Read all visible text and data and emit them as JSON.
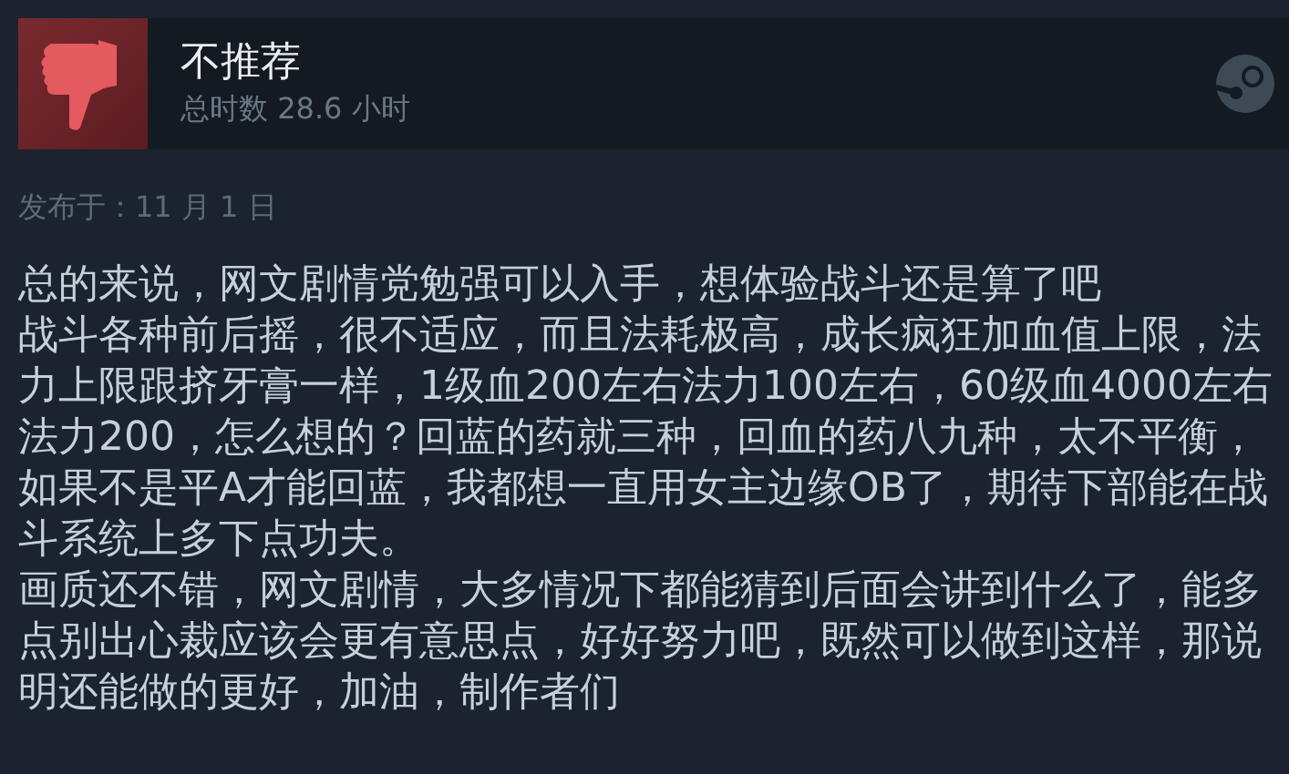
{
  "review": {
    "verdict": "不推荐",
    "playtime": "总时数 28.6 小时",
    "posted": "发布于：11 月 1 日",
    "paragraphs": [
      "总的来说，网文剧情党勉强可以入手，想体验战斗还是算了吧",
      "战斗各种前后摇，很不适应，而且法耗极高，成长疯狂加血值上限，法力上限跟挤牙膏一样，1级血200左右法力100左右，60级血4000左右法力200，怎么想的？回蓝的药就三种，回血的药八九种，太不平衡，如果不是平A才能回蓝，我都想一直用女主边缘OB了，期待下部能在战斗系统上多下点功夫。",
      "画质还不错，网文剧情，大多情况下都能猜到后面会讲到什么了，能多点别出心裁应该会更有意思点，好好努力吧，既然可以做到这样，那说明还能做的更好，加油，制作者们"
    ]
  }
}
